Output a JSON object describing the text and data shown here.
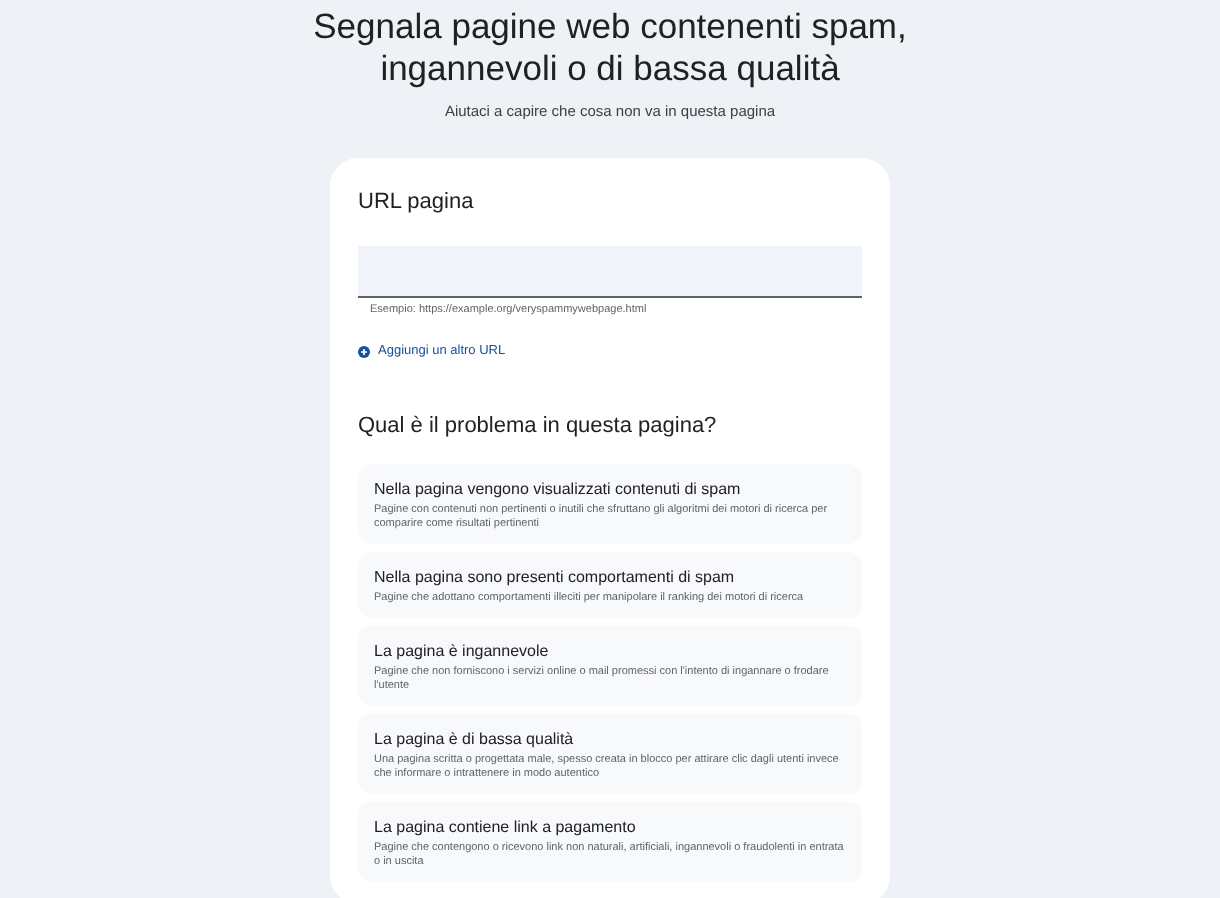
{
  "heading": {
    "title": "Segnala pagine web contenenti spam, ingannevoli o di bassa qualità",
    "subtitle": "Aiutaci a capire che cosa non va in questa pagina"
  },
  "url_section": {
    "label": "URL pagina",
    "hint": "Esempio: https://example.org/veryspammywebpage.html",
    "add_link": "Aggiungi un altro URL"
  },
  "question": "Qual è il problema in questa pagina?",
  "options": [
    {
      "title": "Nella pagina vengono visualizzati contenuti di spam",
      "description": "Pagine con contenuti non pertinenti o inutili che sfruttano gli algoritmi dei motori di ricerca per comparire come risultati pertinenti"
    },
    {
      "title": "Nella pagina sono presenti comportamenti di spam",
      "description": "Pagine che adottano comportamenti illeciti per manipolare il ranking dei motori di ricerca"
    },
    {
      "title": "La pagina è ingannevole",
      "description": "Pagine che non forniscono i servizi online o mail promessi con l'intento di ingannare o frodare l'utente"
    },
    {
      "title": "La pagina è di bassa qualità",
      "description": "Una pagina scritta o progettata male, spesso creata in blocco per attirare clic dagli utenti invece che informare o intrattenere in modo autentico"
    },
    {
      "title": "La pagina contiene link a pagamento",
      "description": "Pagine che contengono o ricevono link non naturali, artificiali, ingannevoli o fraudolenti in entrata o in uscita"
    }
  ]
}
